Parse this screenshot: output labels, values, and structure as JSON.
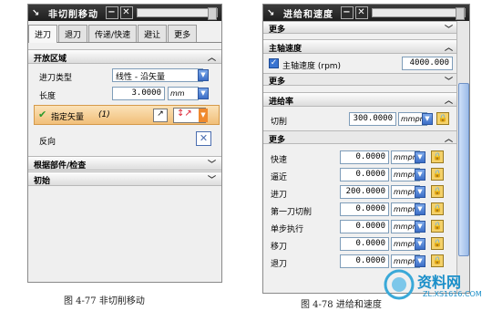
{
  "left_dialog": {
    "title": "非切削移动",
    "title_icon": "↘",
    "title_buttons": [
      "−",
      "✕"
    ],
    "tabs": [
      "进刀",
      "退刀",
      "传递/快速",
      "避让",
      "更多"
    ],
    "section_open_area": "开放区域",
    "engage_type_label": "进刀类型",
    "engage_type_value": "线性 - 沿矢量",
    "length_label": "长度",
    "length_value": "3.0000",
    "length_unit": "mm",
    "specify_vector_label": "指定矢量",
    "specify_vector_count": "(1)",
    "reverse_label": "反向",
    "section_part_check": "根据部件/检查",
    "section_initial": "初始"
  },
  "right_dialog": {
    "title": "进给和速度",
    "title_icon": "↘",
    "title_buttons": [
      "−",
      "✕"
    ],
    "top_more": "更多",
    "section_spindle": "主轴速度",
    "spindle_checkbox_label": "主轴速度 (rpm)",
    "spindle_checked": true,
    "spindle_value": "4000.000",
    "spindle_more": "更多",
    "section_feed": "进给率",
    "cut_label": "切削",
    "cut_value": "300.0000",
    "cut_unit": "mmpr",
    "more_label": "更多",
    "feed_rows": [
      {
        "label": "快速",
        "value": "0.0000",
        "unit": "mmpr"
      },
      {
        "label": "逼近",
        "value": "0.0000",
        "unit": "mmpr"
      },
      {
        "label": "进刀",
        "value": "200.0000",
        "unit": "mmpr"
      },
      {
        "label": "第一刀切削",
        "value": "0.0000",
        "unit": "mmpr"
      },
      {
        "label": "单步执行",
        "value": "0.0000",
        "unit": "mmpr"
      },
      {
        "label": "移刀",
        "value": "0.0000",
        "unit": "mmpr"
      },
      {
        "label": "退刀",
        "value": "0.0000",
        "unit": "mmpr"
      }
    ]
  },
  "captions": {
    "left": "图 4-77  非切削移动",
    "right": "图 4-78  进给和速度"
  },
  "watermark": {
    "brand": "资料网",
    "url": "ZL.XS1616.COM"
  }
}
